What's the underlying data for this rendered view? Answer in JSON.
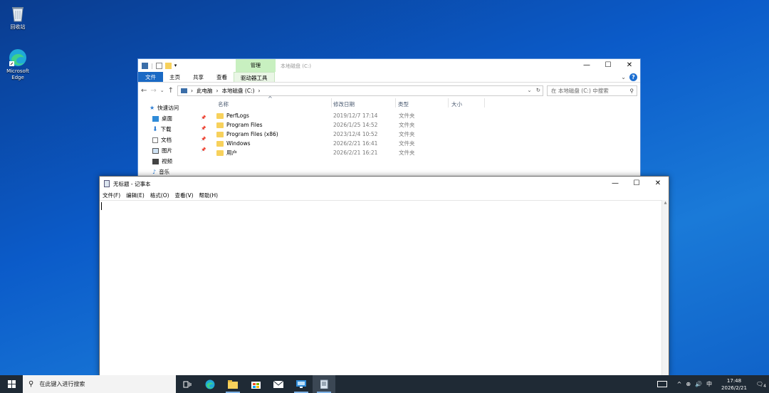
{
  "desktop": {
    "icons": [
      {
        "label": "回收站",
        "icon": "recycle-bin-icon"
      },
      {
        "label": "Microsoft Edge",
        "icon": "edge-icon"
      }
    ]
  },
  "explorer": {
    "title": "本地磁盘 (C:)",
    "context_tab": "管理",
    "ribbon_tabs": [
      "文件",
      "主页",
      "共享",
      "查看",
      "驱动器工具"
    ],
    "breadcrumb": [
      "此电脑",
      "本地磁盘 (C:)"
    ],
    "search_placeholder": "在 本地磁盘 (C:) 中搜索",
    "nav_pane": [
      "快速访问",
      "桌面",
      "下载",
      "文档",
      "图片",
      "视频",
      "音乐"
    ],
    "columns": [
      "名称",
      "修改日期",
      "类型",
      "大小"
    ],
    "files": [
      {
        "name": "PerfLogs",
        "date": "2019/12/7 17:14",
        "type": "文件夹"
      },
      {
        "name": "Program Files",
        "date": "2026/1/25 14:52",
        "type": "文件夹"
      },
      {
        "name": "Program Files (x86)",
        "date": "2023/12/4 10:52",
        "type": "文件夹"
      },
      {
        "name": "Windows",
        "date": "2026/2/21 16:41",
        "type": "文件夹"
      },
      {
        "name": "用户",
        "date": "2026/2/21 16:21",
        "type": "文件夹"
      }
    ]
  },
  "notepad": {
    "title": "无标题 - 记事本",
    "menu": [
      "文件(F)",
      "编辑(E)",
      "格式(O)",
      "查看(V)",
      "帮助(H)"
    ],
    "content": ""
  },
  "taskbar": {
    "search_placeholder": "在此键入进行搜索",
    "ime": "中",
    "time": "17:48",
    "date": "2026/2/21",
    "notification_count": "4"
  },
  "colors": {
    "accent": "#1a69c4",
    "taskbar": "#1f2a35",
    "context_tab": "#c8f0c0"
  }
}
